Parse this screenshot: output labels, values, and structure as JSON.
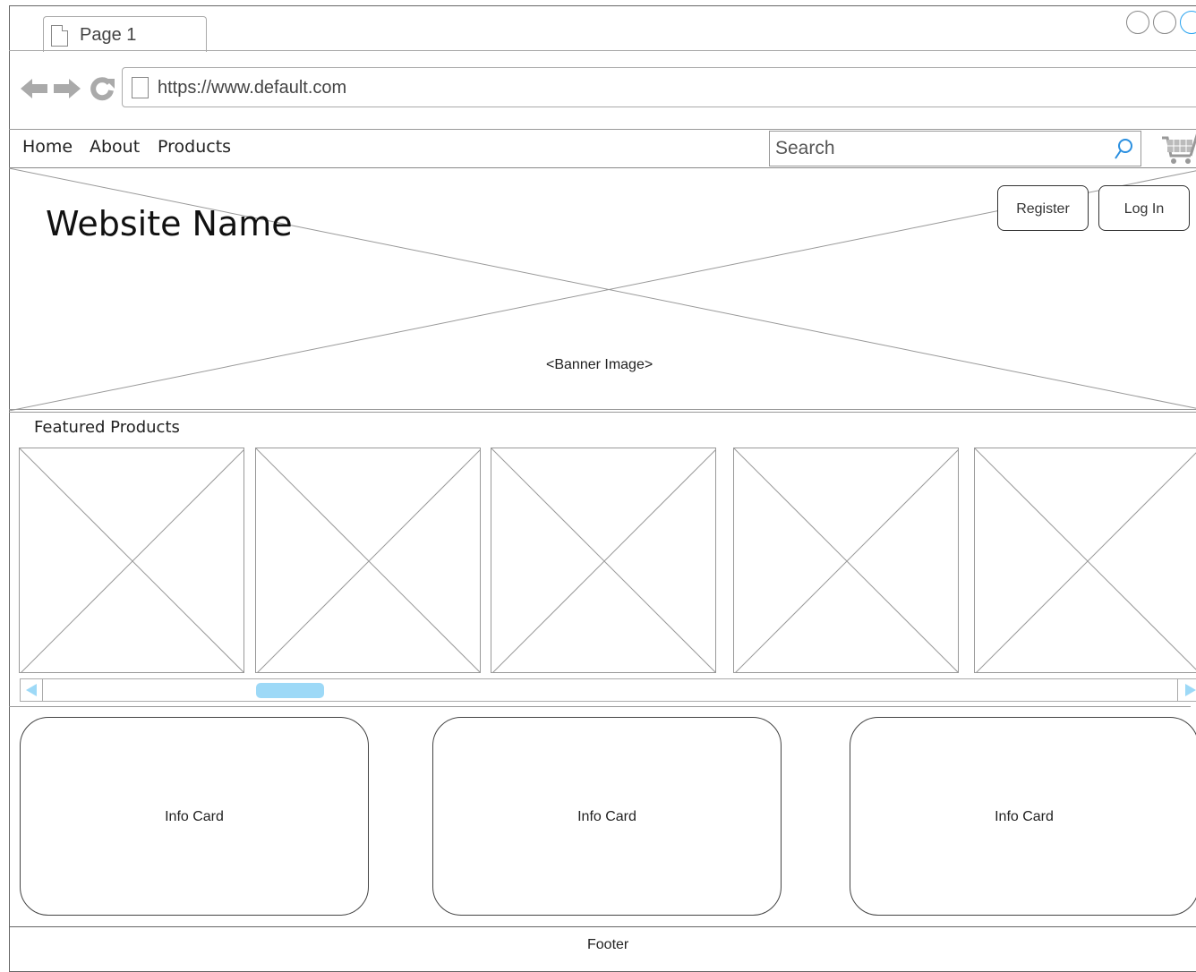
{
  "browser": {
    "tab_label": "Page 1",
    "url": "https://www.default.com"
  },
  "nav": {
    "links": [
      "Home",
      "About",
      "Products"
    ],
    "search_placeholder": "Search"
  },
  "banner": {
    "site_name": "Website Name",
    "image_label": "<Banner Image>",
    "register_label": "Register",
    "login_label": "Log In"
  },
  "featured": {
    "title": "Featured Products",
    "product_count": 5
  },
  "scrollbar": {
    "accent_color": "#9dd9f7",
    "arrow_color": "#4aa8ea"
  },
  "cards": [
    "Info Card",
    "Info Card",
    "Info Card"
  ],
  "footer": {
    "label": "Footer"
  },
  "icons": {
    "back": "arrow-left-icon",
    "forward": "arrow-right-icon",
    "reload": "reload-icon",
    "search": "search-icon",
    "cart": "cart-icon"
  }
}
